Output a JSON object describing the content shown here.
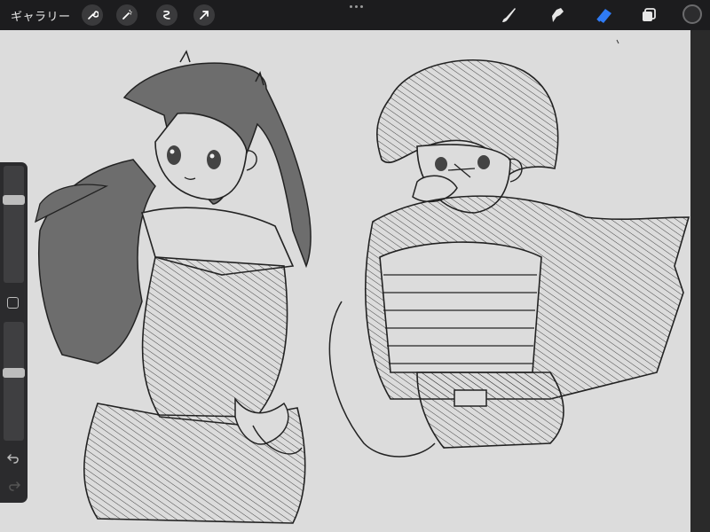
{
  "toolbar": {
    "gallery_label": "ギャラリー",
    "left_tools": [
      "wrench-icon",
      "magic-wand-icon",
      "selection-icon",
      "transform-arrow-icon"
    ],
    "right_tools": [
      "brush-icon",
      "smudge-icon",
      "eraser-icon",
      "layers-icon"
    ],
    "active_tool": "eraser",
    "active_color": "#2c2c2e",
    "accent": "#2f7bf5"
  },
  "sidebar": {
    "brush_size_level": 0.73,
    "opacity_level": 0.58,
    "undo_icon": "undo-icon",
    "redo_icon": "redo-icon"
  },
  "canvas": {
    "background": "#dcdcdc",
    "artwork": "line-art-sketch"
  }
}
